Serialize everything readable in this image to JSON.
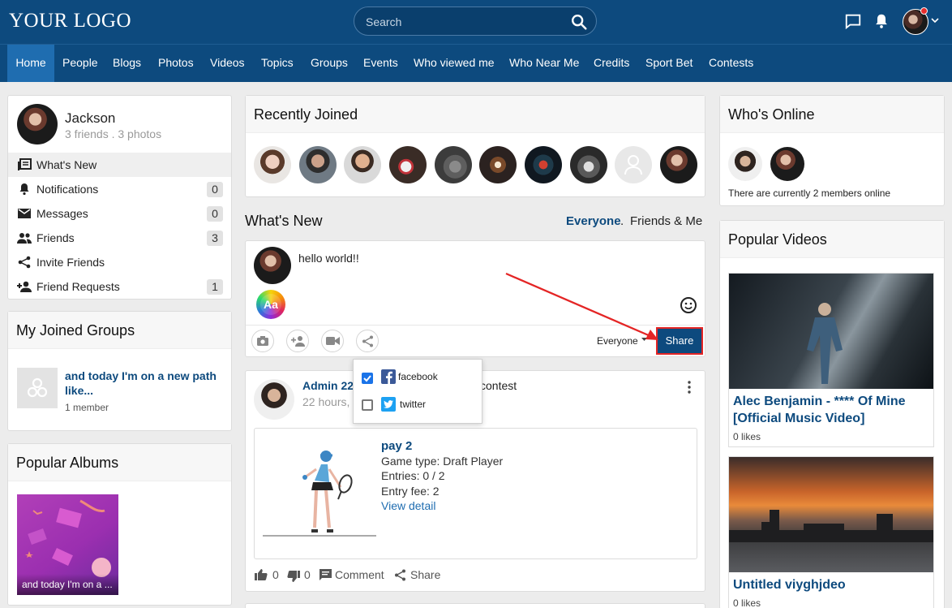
{
  "header": {
    "logo": "YOUR LOGO",
    "search_placeholder": "Search"
  },
  "nav": {
    "items": [
      "Home",
      "People",
      "Blogs",
      "Photos",
      "Videos",
      "Topics",
      "Groups",
      "Events",
      "Who viewed me",
      "Who Near Me",
      "Credits",
      "Sport Bet",
      "Contests"
    ],
    "active": "Home"
  },
  "profile": {
    "name": "Jackson",
    "stats": "3 friends . 3 photos",
    "menu": [
      {
        "label": "What's New",
        "count": ""
      },
      {
        "label": "Notifications",
        "count": "0"
      },
      {
        "label": "Messages",
        "count": "0"
      },
      {
        "label": "Friends",
        "count": "3"
      },
      {
        "label": "Invite Friends",
        "count": ""
      },
      {
        "label": "Friend Requests",
        "count": "1"
      }
    ]
  },
  "groups": {
    "title": "My Joined Groups",
    "item_title": "and today I'm on a new path like...",
    "item_members": "1 member"
  },
  "albums": {
    "title": "Popular Albums",
    "item_caption": "and today I'm on a ..."
  },
  "recently_joined": {
    "title": "Recently Joined"
  },
  "whats_new": {
    "title": "What's New",
    "filter_everyone": "Everyone",
    "filter_sep": ".",
    "filter_friends": "Friends & Me"
  },
  "composer": {
    "text": "hello world!!",
    "aa_label": "Aa",
    "privacy": "Everyone",
    "share_label": "Share"
  },
  "share_dropdown": {
    "options": [
      {
        "label": "facebook",
        "checked": true
      },
      {
        "label": "twitter",
        "checked": false
      }
    ]
  },
  "post": {
    "author": "Admin 220",
    "action_suffix": "contest",
    "time": "22 hours, S",
    "contest_title": "pay 2",
    "game_type": "Game type: Draft Player",
    "entries": "Entries: 0 / 2",
    "entry_fee": "Entry fee: 2",
    "view_detail": "View detail",
    "likes": "0",
    "dislikes": "0",
    "comment_label": "Comment",
    "share_label": "Share"
  },
  "online": {
    "title": "Who's Online",
    "text": "There are currently 2 members online"
  },
  "videos": {
    "title": "Popular Videos",
    "items": [
      {
        "title": "Alec Benjamin - **** Of Mine [Official Music Video]",
        "likes": "0 likes"
      },
      {
        "title": "Untitled viyghjdeo",
        "likes": "0 likes"
      }
    ]
  },
  "colors": {
    "brand": "#0d4a7e",
    "highlight": "#e42525"
  }
}
